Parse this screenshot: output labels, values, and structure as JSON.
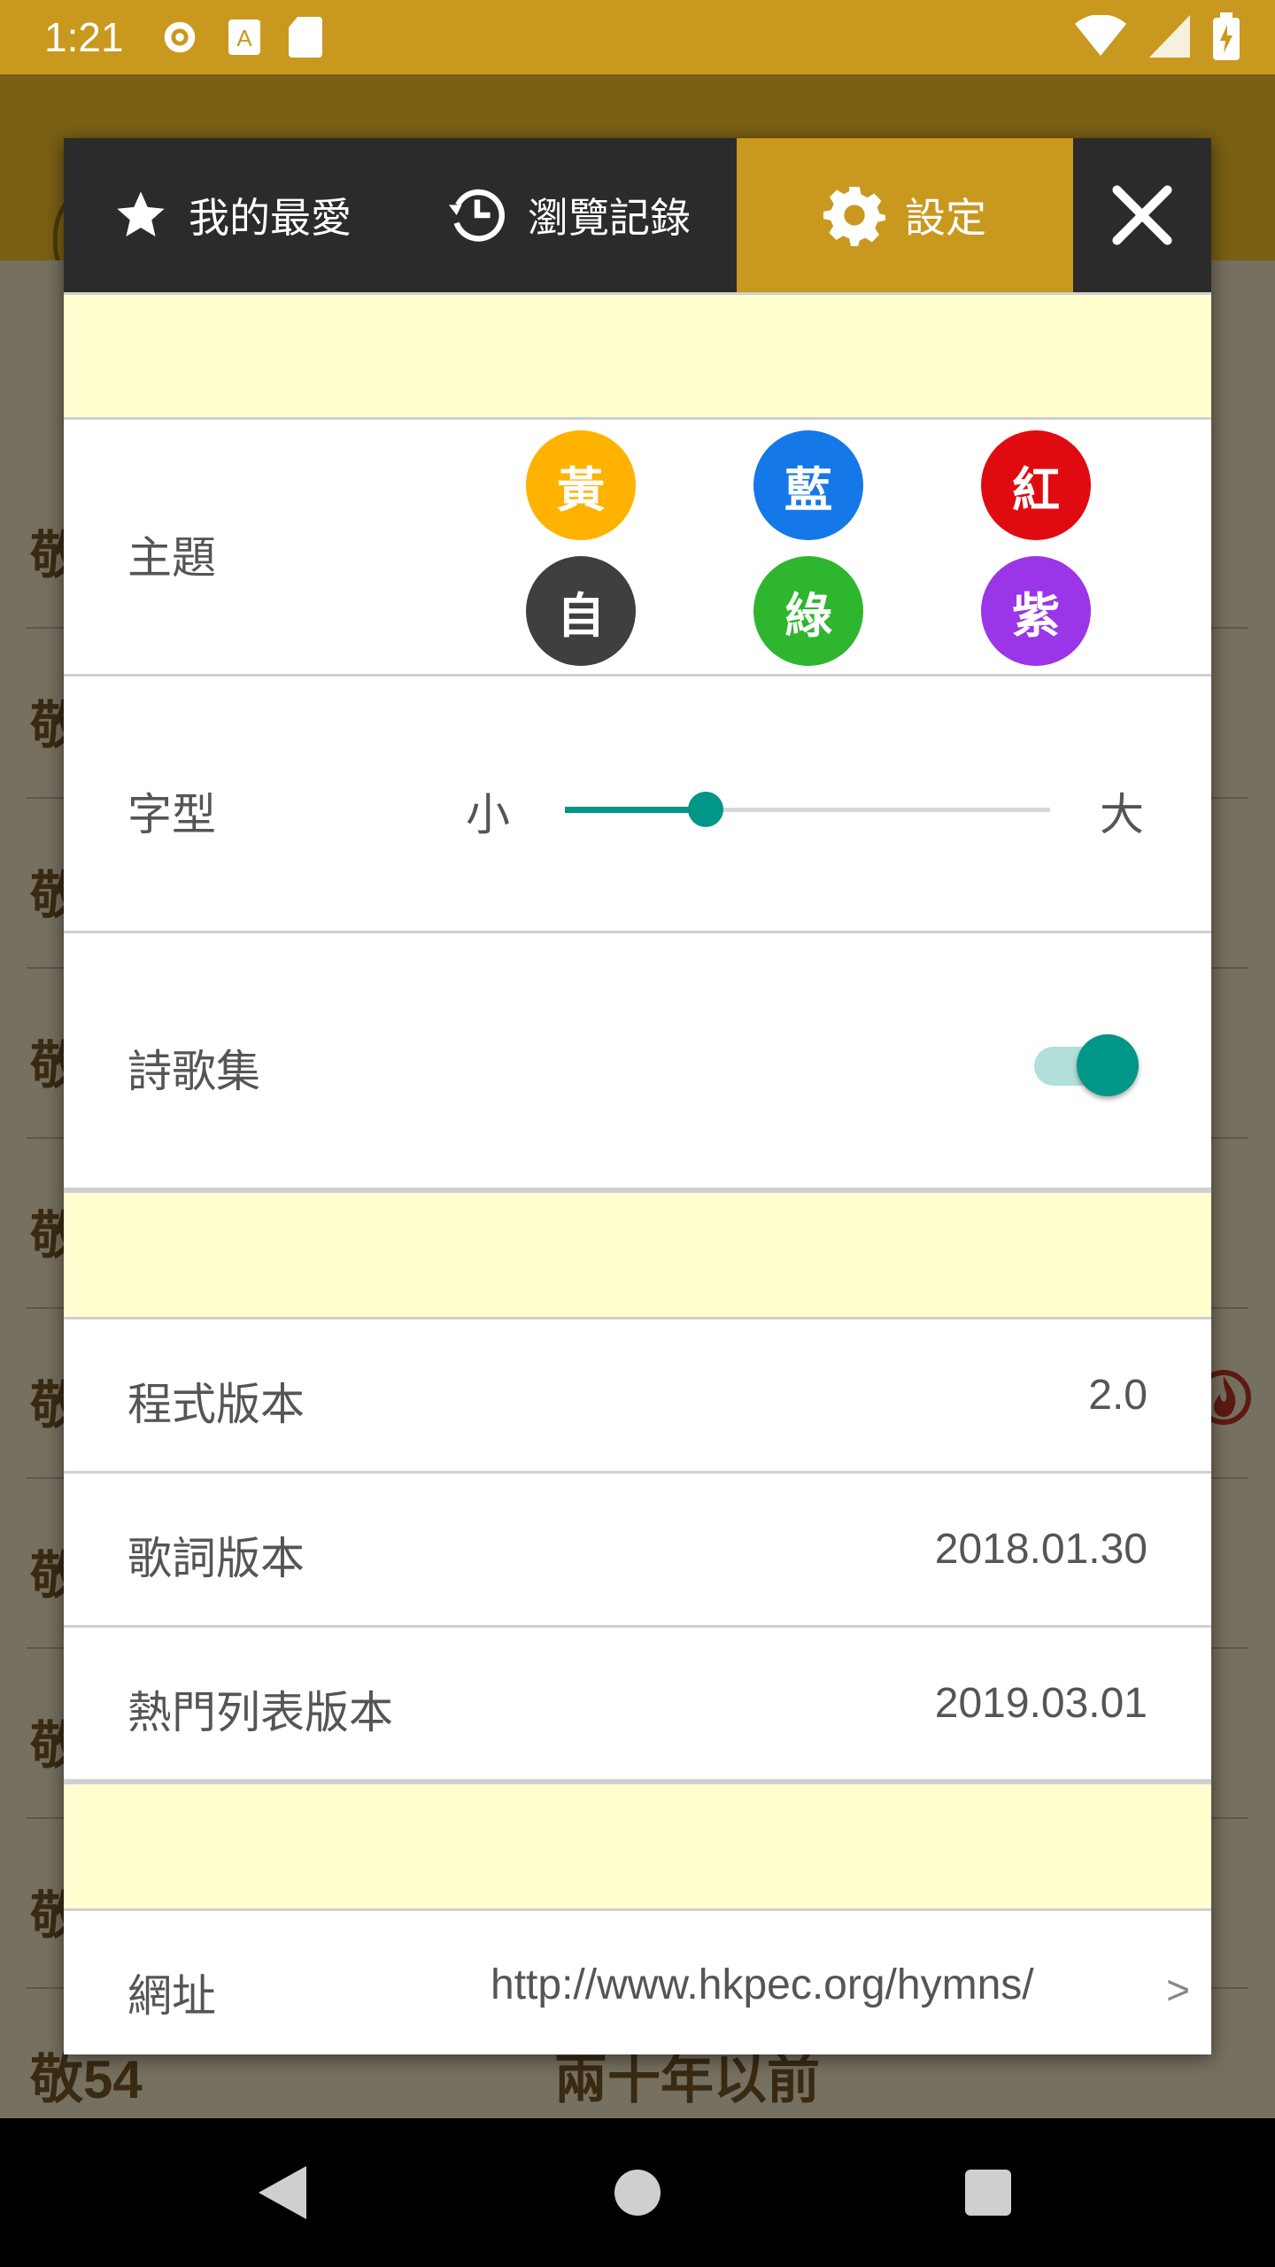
{
  "status_bar": {
    "time": "1:21"
  },
  "background_list": {
    "bottom_left": "敬54",
    "bottom_center": "兩十年以前",
    "row_char": "敬"
  },
  "dialog": {
    "tabs": {
      "favorites": "我的最愛",
      "history": "瀏覽記錄",
      "settings": "設定"
    },
    "theme": {
      "label": "主題",
      "options": [
        {
          "text": "黃",
          "color": "#ffb300"
        },
        {
          "text": "藍",
          "color": "#1478e8"
        },
        {
          "text": "紅",
          "color": "#e00b10"
        },
        {
          "text": "自",
          "color": "#3f3f3f"
        },
        {
          "text": "綠",
          "color": "#2eb62e"
        },
        {
          "text": "紫",
          "color": "#9a35e8"
        }
      ]
    },
    "font": {
      "label": "字型",
      "small": "小",
      "large": "大",
      "level": 0.29
    },
    "hymnbook": {
      "label": "詩歌集",
      "enabled": true
    },
    "app_version": {
      "label": "程式版本",
      "value": "2.0"
    },
    "lyrics_version": {
      "label": "歌詞版本",
      "value": "2018.01.30"
    },
    "hot_list_version": {
      "label": "熱門列表版本",
      "value": "2019.03.01"
    },
    "website": {
      "label": "網址",
      "value": "http://www.hkpec.org/hymns/",
      "arrow": ">"
    }
  },
  "colors": {
    "accent": "#c9981e",
    "band": "#ffffd0",
    "teal": "#009688"
  }
}
